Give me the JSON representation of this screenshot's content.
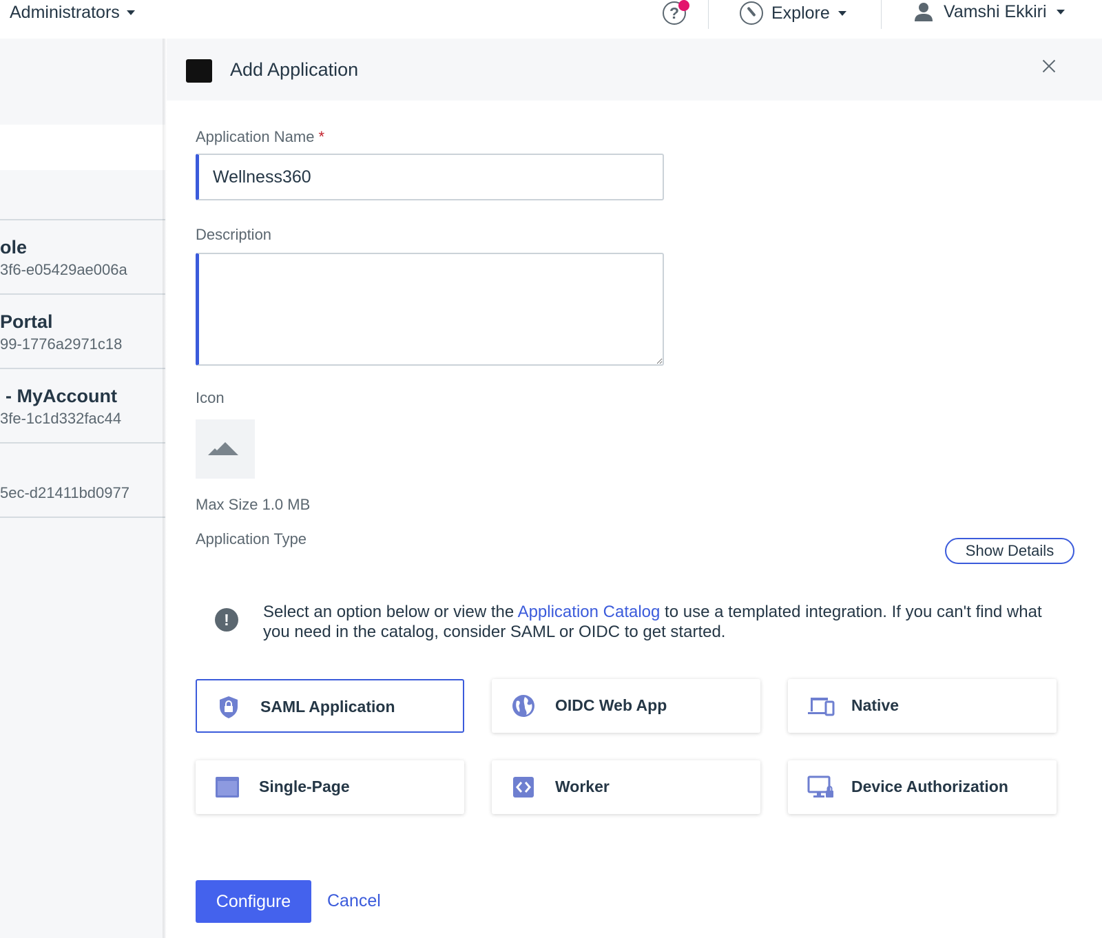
{
  "topbar": {
    "environment": "Administrators",
    "explore": "Explore",
    "user_name": "Vamshi Ekkiri"
  },
  "left_list": {
    "items": [
      {
        "title": "ole",
        "subtitle": "3f6-e05429ae006a"
      },
      {
        "title": "Portal",
        "subtitle": "99-1776a2971c18"
      },
      {
        "title": "- MyAccount",
        "subtitle": "3fe-1c1d332fac44"
      },
      {
        "title": "",
        "subtitle": "5ec-d21411bd0977"
      }
    ]
  },
  "panel": {
    "title": "Add Application",
    "app_name_label": "Application Name",
    "required_mark": "*",
    "app_name_value": "Wellness360",
    "description_label": "Description",
    "description_value": "",
    "icon_label": "Icon",
    "max_size": "Max Size 1.0 MB",
    "app_type_label": "Application Type",
    "show_details": "Show Details",
    "info_before": "Select an option below or view the ",
    "info_link": "Application Catalog",
    "info_after": " to use a templated integration. If you can't find what you need in the catalog, consider SAML or OIDC to get started.",
    "types": [
      {
        "label": "SAML Application",
        "icon": "shield-lock-icon",
        "selected": true
      },
      {
        "label": "OIDC Web App",
        "icon": "globe-icon",
        "selected": false
      },
      {
        "label": "Native",
        "icon": "devices-icon",
        "selected": false
      },
      {
        "label": "Single-Page",
        "icon": "browser-window-icon",
        "selected": false
      },
      {
        "label": "Worker",
        "icon": "code-icon",
        "selected": false
      },
      {
        "label": "Device Authorization",
        "icon": "monitor-lock-icon",
        "selected": false
      }
    ],
    "configure": "Configure",
    "cancel": "Cancel"
  },
  "colors": {
    "accent": "#3b5bdb",
    "primary_button": "#4462ed",
    "icon_purple": "#6e7fd0",
    "notification": "#e3146c"
  }
}
